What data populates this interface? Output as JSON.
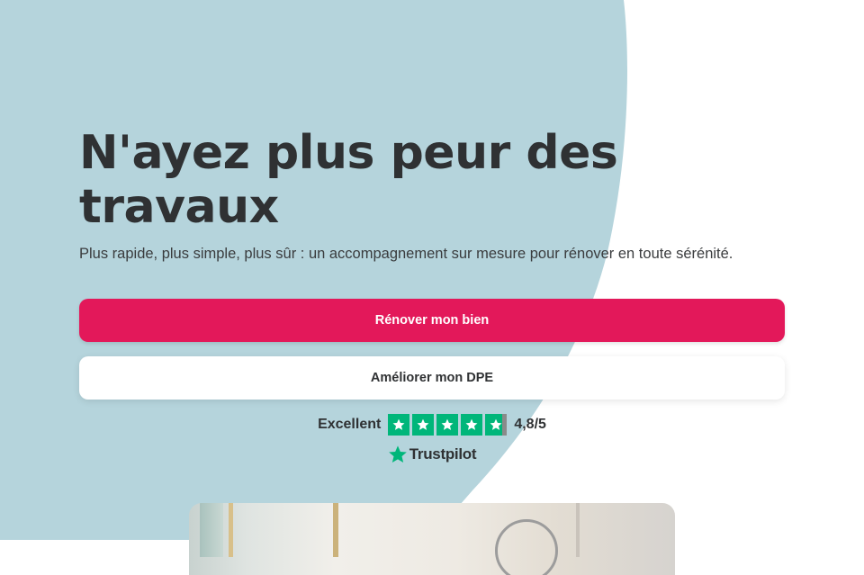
{
  "hero": {
    "title": "N'ayez plus peur des travaux",
    "subtitle": "Plus rapide, plus simple, plus sûr : un accompagnement sur mesure pour rénover en toute sérénité."
  },
  "actions": {
    "primary_label": "Rénover mon bien",
    "secondary_label": "Améliorer mon DPE"
  },
  "rating": {
    "label": "Excellent",
    "score": "4,8/5",
    "stars_value": 4.8,
    "stars_max": 5,
    "provider": "Trustpilot"
  },
  "colors": {
    "accent": "#e3185a",
    "blob": "#b5d4dc",
    "trustpilot_green": "#00b67a",
    "text": "#2f3133"
  },
  "icons": {
    "star": "star-icon",
    "trustpilot_logo": "trustpilot-star-icon"
  }
}
